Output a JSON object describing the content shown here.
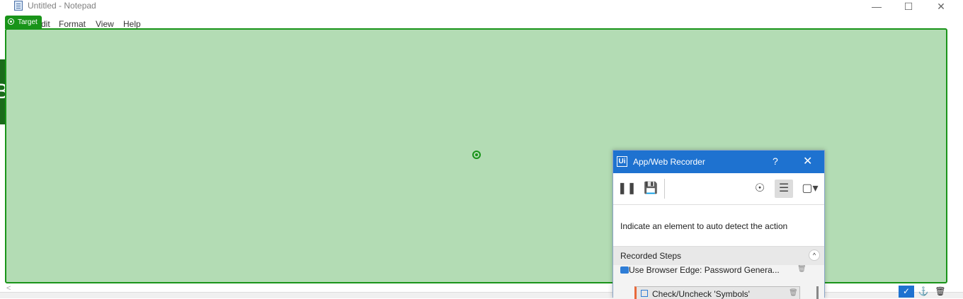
{
  "window": {
    "title": "Untitled - Notepad",
    "minimize": "—",
    "maximize": "☐",
    "close": "✕"
  },
  "menu": {
    "edit": "dit",
    "format": "Format",
    "view": "View",
    "help": "Help"
  },
  "target_tag": "Target",
  "side_tab_text": "B",
  "scroll_left": "<",
  "recorder": {
    "logo": "Ui",
    "title": "App/Web Recorder",
    "help": "?",
    "close": "✕",
    "message": "Indicate an element to auto detect the action",
    "steps_header": "Recorded Steps",
    "collapse": "^",
    "steps": [
      {
        "label": "Use Browser Edge: Password Genera..."
      },
      {
        "label": "Check/Uncheck 'Symbols'"
      }
    ]
  },
  "colors": {
    "target_green": "#199419",
    "overlay_fill": "#b3dcb4",
    "recorder_blue": "#1e72d0"
  }
}
